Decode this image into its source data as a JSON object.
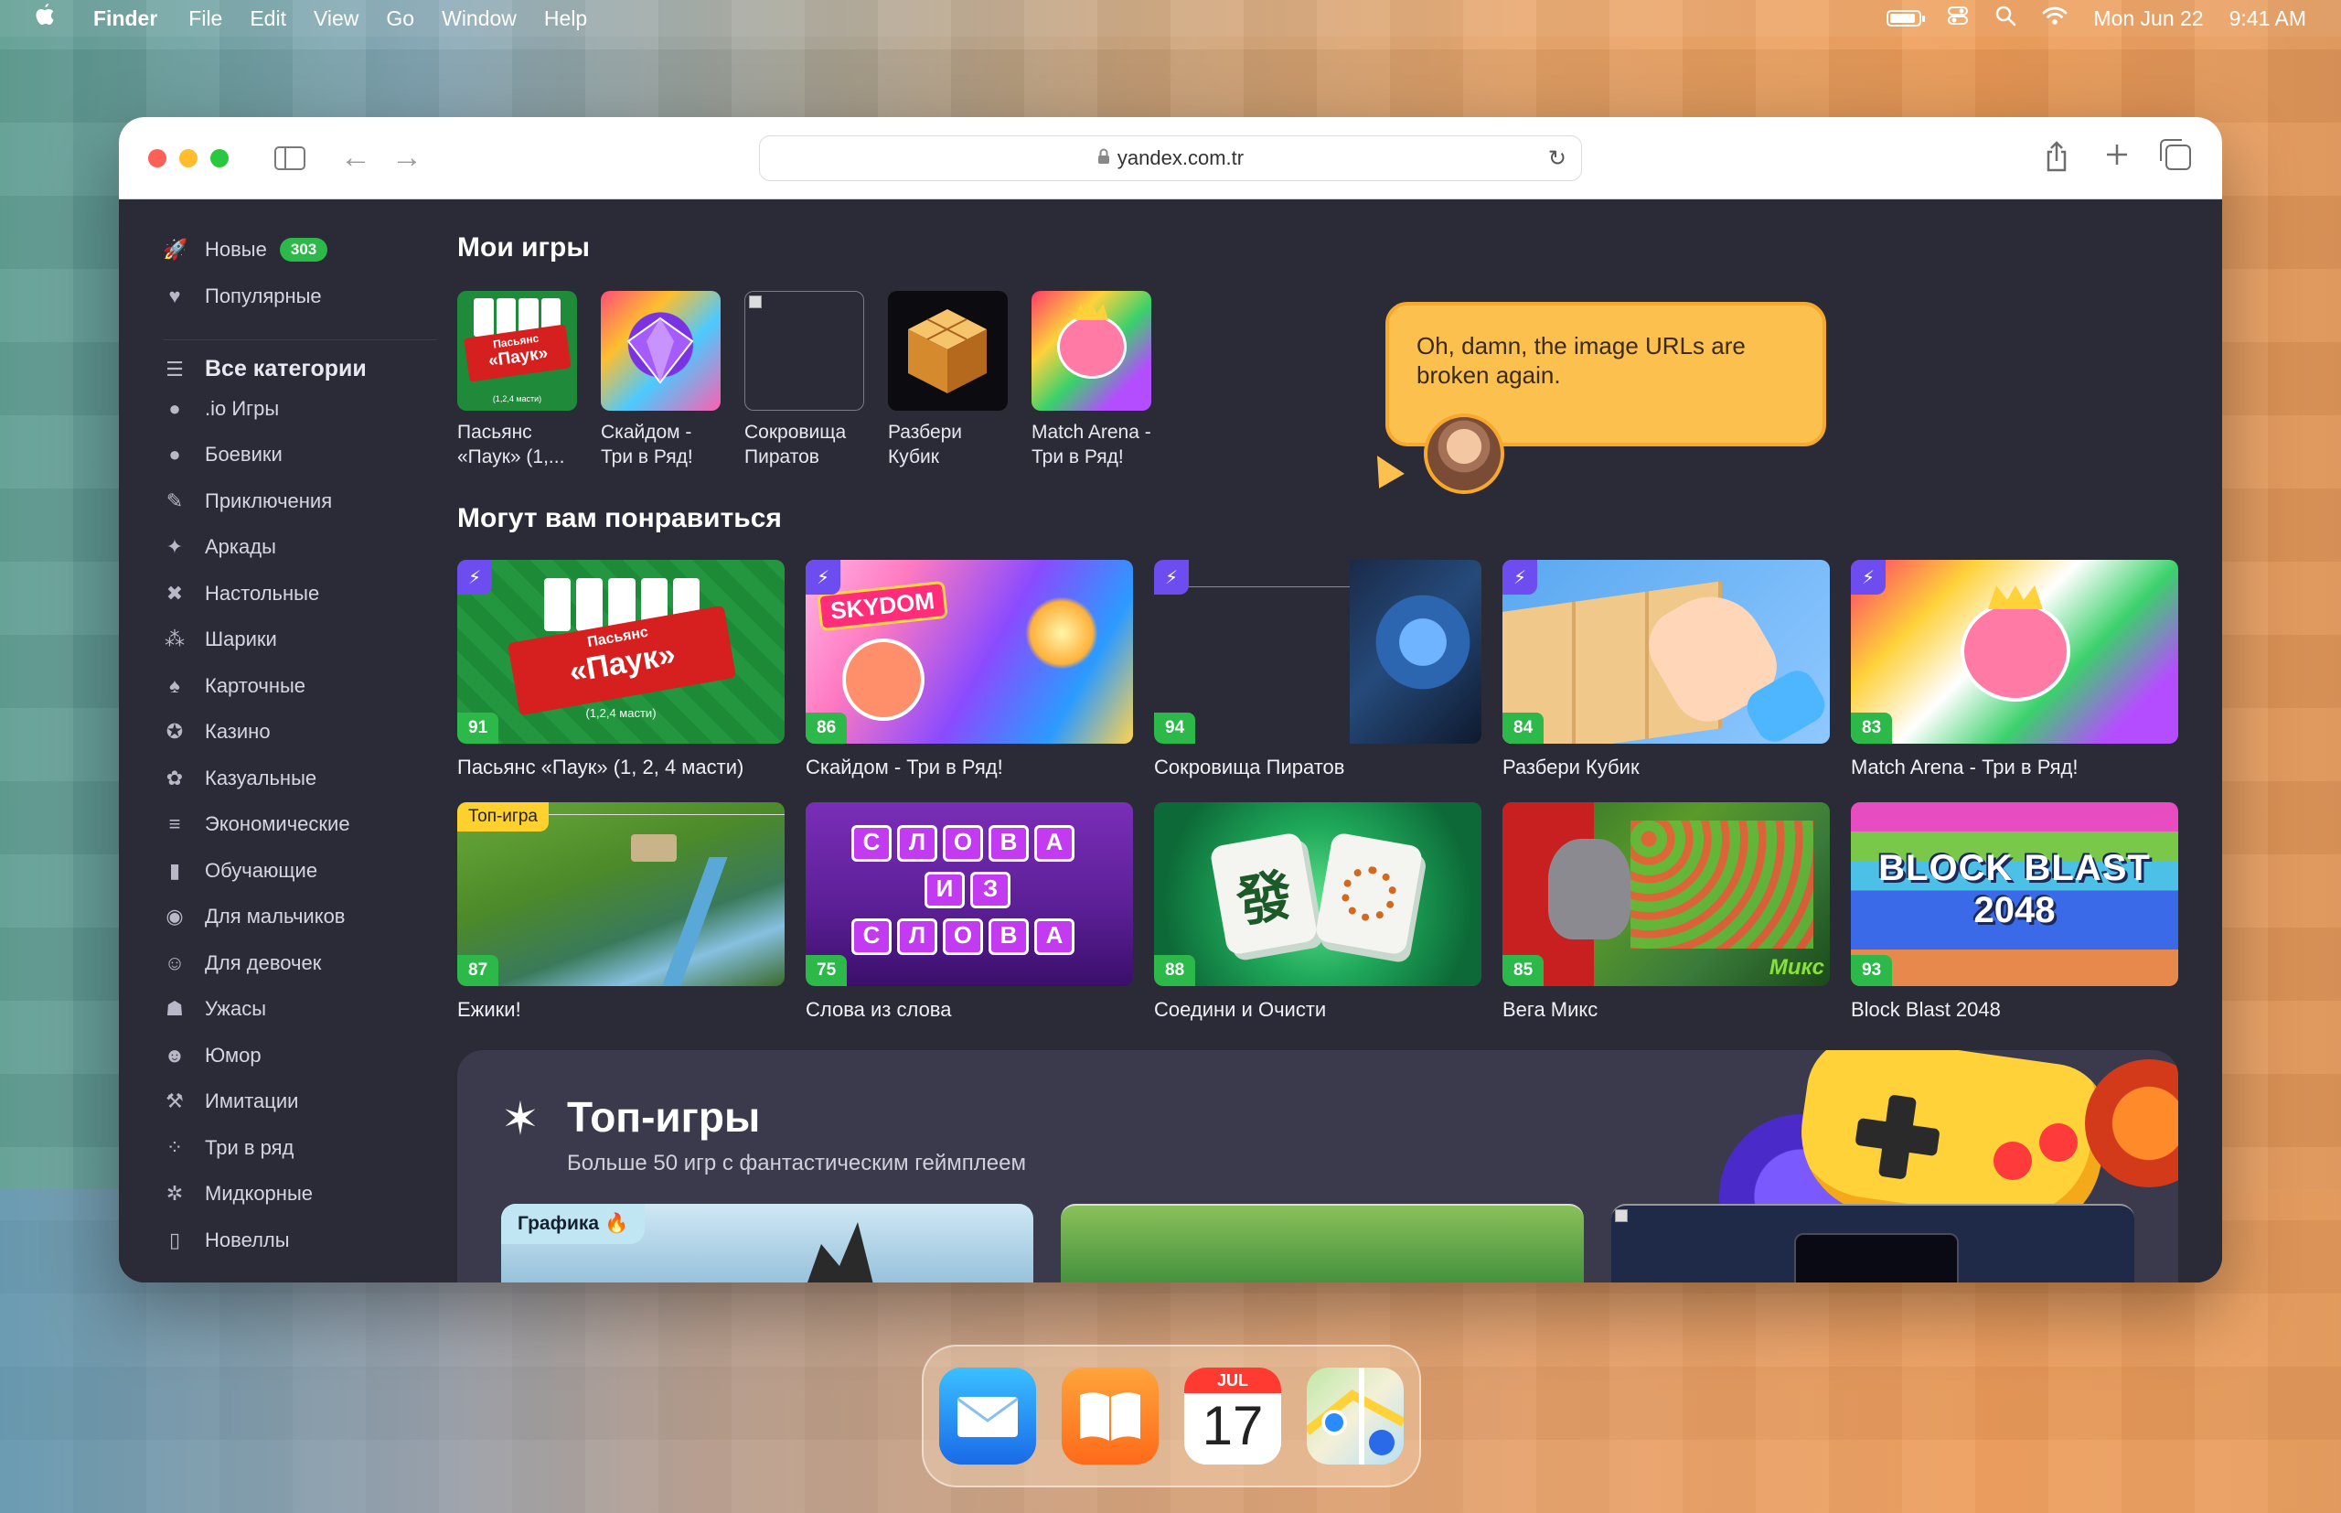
{
  "menubar": {
    "app_name": "Finder",
    "items": [
      "File",
      "Edit",
      "View",
      "Go",
      "Window",
      "Help"
    ],
    "date": "Mon Jun 22",
    "time": "9:41 AM"
  },
  "browser": {
    "url": "yandex.com.tr"
  },
  "sidebar": {
    "items": [
      {
        "label": "Новые",
        "icon": "rocket-icon",
        "badge": "303"
      },
      {
        "label": "Популярные",
        "icon": "heart-icon"
      },
      {
        "label": "Все категории",
        "icon": "list-icon"
      },
      {
        "label": ".io Игры",
        "icon": "io-icon"
      },
      {
        "label": "Боевики",
        "icon": "bomb-icon"
      },
      {
        "label": "Приключения",
        "icon": "adventure-icon"
      },
      {
        "label": "Аркады",
        "icon": "runner-icon"
      },
      {
        "label": "Настольные",
        "icon": "board-icon"
      },
      {
        "label": "Шарики",
        "icon": "balls-icon"
      },
      {
        "label": "Карточные",
        "icon": "spade-icon"
      },
      {
        "label": "Казино",
        "icon": "chip-icon"
      },
      {
        "label": "Казуальные",
        "icon": "casual-icon"
      },
      {
        "label": "Экономические",
        "icon": "coins-icon"
      },
      {
        "label": "Обучающие",
        "icon": "book-icon"
      },
      {
        "label": "Для мальчиков",
        "icon": "mask-icon"
      },
      {
        "label": "Для девочек",
        "icon": "girl-icon"
      },
      {
        "label": "Ужасы",
        "icon": "ghost-icon"
      },
      {
        "label": "Юмор",
        "icon": "smile-icon"
      },
      {
        "label": "Имитации",
        "icon": "hammer-icon"
      },
      {
        "label": "Три в ряд",
        "icon": "match-icon"
      },
      {
        "label": "Мидкорные",
        "icon": "gear-icon"
      },
      {
        "label": "Новеллы",
        "icon": "novel-icon"
      }
    ]
  },
  "my_games": {
    "title": "Мои игры",
    "items": [
      {
        "name": "Пасьянс «Паук» (1,..."
      },
      {
        "name": "Скайдом - Три в Ряд!"
      },
      {
        "name": "Сокровища Пиратов"
      },
      {
        "name": "Разбери Кубик"
      },
      {
        "name": "Match Arena - Три в Ряд!"
      }
    ]
  },
  "tooltip": {
    "text": "Oh, damn, the image URLs are broken again."
  },
  "recommended": {
    "title": "Могут вам понравиться",
    "items": [
      {
        "name": "Пасьянс «Паук» (1, 2, 4 масти)",
        "score": "91",
        "flash": true
      },
      {
        "name": "Скайдом - Три в Ряд!",
        "score": "86",
        "flash": true
      },
      {
        "name": "Сокровища Пиратов",
        "score": "94",
        "flash": true
      },
      {
        "name": "Разбери Кубик",
        "score": "84",
        "flash": true
      },
      {
        "name": "Match Arena - Три в Ряд!",
        "score": "83",
        "flash": true
      },
      {
        "name": "Ежики!",
        "score": "87",
        "label": "Топ-игра"
      },
      {
        "name": "Слова из слова",
        "score": "75"
      },
      {
        "name": "Соедини и Очисти",
        "score": "88"
      },
      {
        "name": "Вега Микс",
        "score": "85"
      },
      {
        "name": "Block Blast 2048",
        "score": "93"
      }
    ]
  },
  "top_games": {
    "title": "Топ-игры",
    "subtitle": "Больше 50 игр с фантастическим геймплеем",
    "strip_label": "Графика"
  },
  "thumb_text": {
    "spider_small_1": "Пасьянс",
    "spider_small_2": "«Паук»",
    "spider_small_3": "(1,2,4 масти)",
    "spider_big_1": "Пасьянс",
    "spider_big_2": "«Паук»",
    "spider_big_3": "(1,2,4 масти)",
    "skydom": "SKYDOM",
    "words_1": [
      "С",
      "Л",
      "О",
      "В",
      "А"
    ],
    "words_2": [
      "И",
      "З"
    ],
    "words_3": [
      "С",
      "Л",
      "О",
      "В",
      "А"
    ],
    "block_1": "BLOCK BLAST",
    "block_2": "2048",
    "vega": "Микс",
    "mahjong": "發"
  },
  "dock": {
    "apps": [
      "Mail",
      "Books",
      "Calendar",
      "Maps"
    ],
    "calendar_month": "JUL",
    "calendar_day": "17"
  },
  "colors": {
    "content_bg": "#2b2a37",
    "score_green": "#2db84a",
    "flash_purple": "#6e4df0",
    "tooltip_yellow": "#fbc04e"
  }
}
